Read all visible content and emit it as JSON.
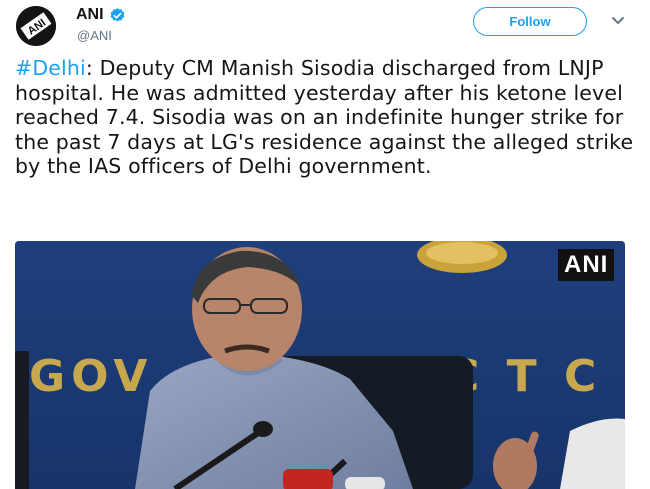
{
  "header": {
    "display_name": "ANI",
    "handle": "@ANI",
    "avatar_text": "ANI",
    "follow_label": "Follow",
    "accent_color": "#1da1f2"
  },
  "tweet": {
    "hashtag": "#Delhi",
    "body": ": Deputy CM Manish Sisodia discharged from LNJP hospital. He was admitted yesterday after his ketone level reached 7.4. Sisodia was on an indefinite hunger strike for the past 7 days at LG's residence against the alleged strike by the IAS officers of Delhi government."
  },
  "media": {
    "watermark": "ANI",
    "backdrop_text_left": "GOV",
    "backdrop_text_right": "C T   C"
  },
  "icons": {
    "verified": "verified-badge-icon",
    "caret": "chevron-down-icon"
  }
}
